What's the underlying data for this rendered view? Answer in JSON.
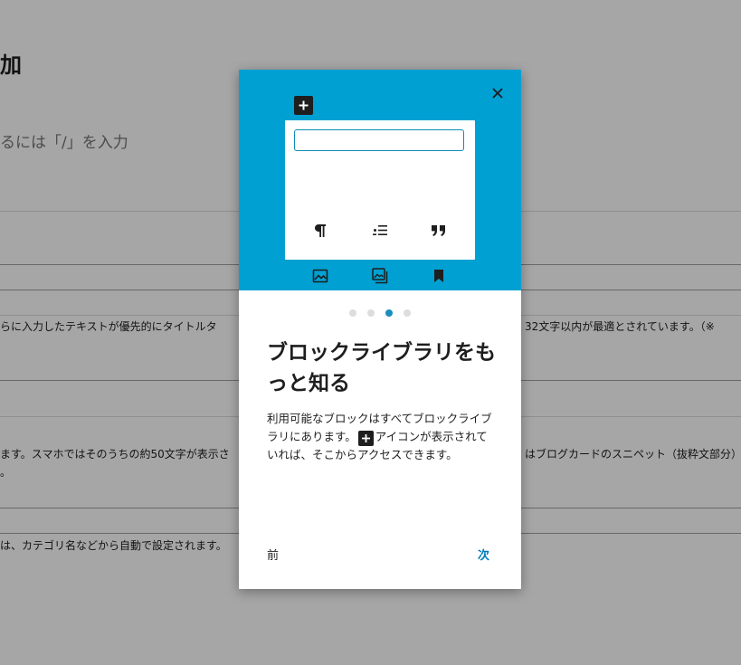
{
  "background": {
    "title_fragment": "加",
    "placeholder_fragment": "るには「/」を入力",
    "row1_left": "らに入力したテキストが優先的にタイトルタ",
    "row1_right": "32文字以内が最適とされています。（※",
    "row2_left": "ます。スマホではそのうちの約50文字が表示さ",
    "row2_right": "はブログカードのスニペット（抜粋文部分）",
    "row2_cont": "。",
    "row3_left": "は、カテゴリ名などから自動で設定されます。"
  },
  "guide": {
    "close_icon": "close-icon",
    "plus_icon": "plus-icon",
    "inserter_icons": [
      "paragraph-icon",
      "list-icon",
      "quote-icon",
      "image-icon",
      "gallery-icon",
      "bookmark-icon"
    ],
    "pager": {
      "total": 4,
      "current": 3
    },
    "heading": "ブロックライブラリをもっと知る",
    "text_before": "利用可能なブロックはすべてブロックライブラリにあります。",
    "text_after": "アイコンが表示されていれば、そこからアクセスできます。",
    "prev_label": "前",
    "next_label": "次"
  },
  "colors": {
    "guide_header": "#00a0d2",
    "accent": "#007cba",
    "dot_active": "#1a8fbd",
    "dot_inactive": "#dddddd"
  }
}
